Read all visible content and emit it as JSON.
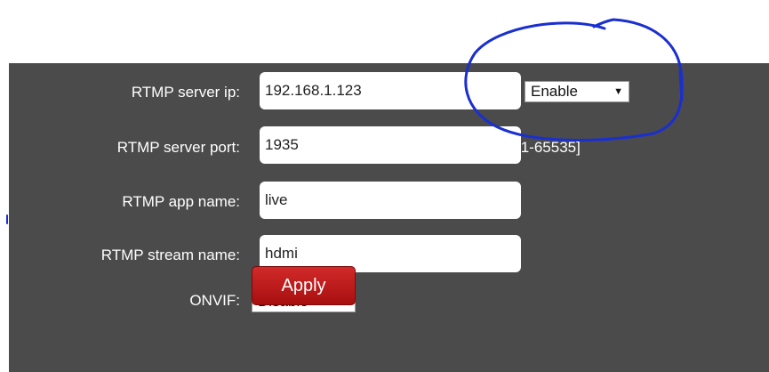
{
  "form": {
    "rtmp_server_ip": {
      "label": "RTMP server ip:",
      "value": "192.168.1.123",
      "select_value": "Enable"
    },
    "rtmp_server_port": {
      "label": "RTMP server port:",
      "value": "1935",
      "range_hint": "[1-65535]"
    },
    "rtmp_app_name": {
      "label": "RTMP app name:",
      "value": "live"
    },
    "rtmp_stream_name": {
      "label": "RTMP stream name:",
      "value": "hdmi"
    },
    "onvif": {
      "label": "ONVIF:",
      "select_value": "Disable"
    },
    "apply_label": "Apply"
  },
  "colors": {
    "panel_background": "#4b4b4b",
    "apply_button": "#c01b1b",
    "annotation_ink": "#1a2fd0"
  },
  "icons": {
    "select_arrow": "dropdown-arrow-icon"
  }
}
